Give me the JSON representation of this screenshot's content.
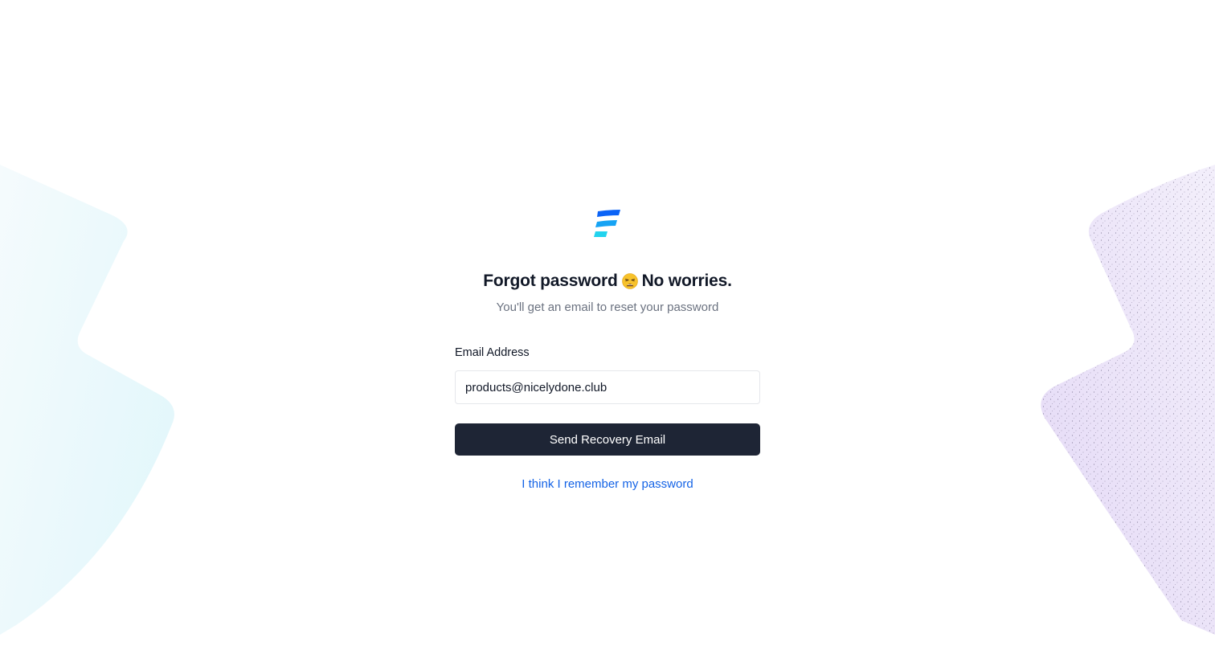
{
  "colors": {
    "accent_link": "#1463e6",
    "button_bg": "#1e2535",
    "logo_dark": "#0b63f6",
    "logo_mid": "#16a3f4",
    "logo_light": "#22d3ee",
    "bg_left_tint": "#e0f7fb",
    "bg_right_tint": "#e6ddf8"
  },
  "logo": {
    "icon": "brand-logo-icon"
  },
  "heading": {
    "before_emoji": "Forgot password",
    "emoji": "weary-face-emoji",
    "after_emoji": "No worries."
  },
  "subtitle": "You'll get an email to reset your password",
  "form": {
    "email_label": "Email Address",
    "email_value": "products@nicelydone.club",
    "submit_label": "Send Recovery Email"
  },
  "footer_link": "I think I remember my password"
}
